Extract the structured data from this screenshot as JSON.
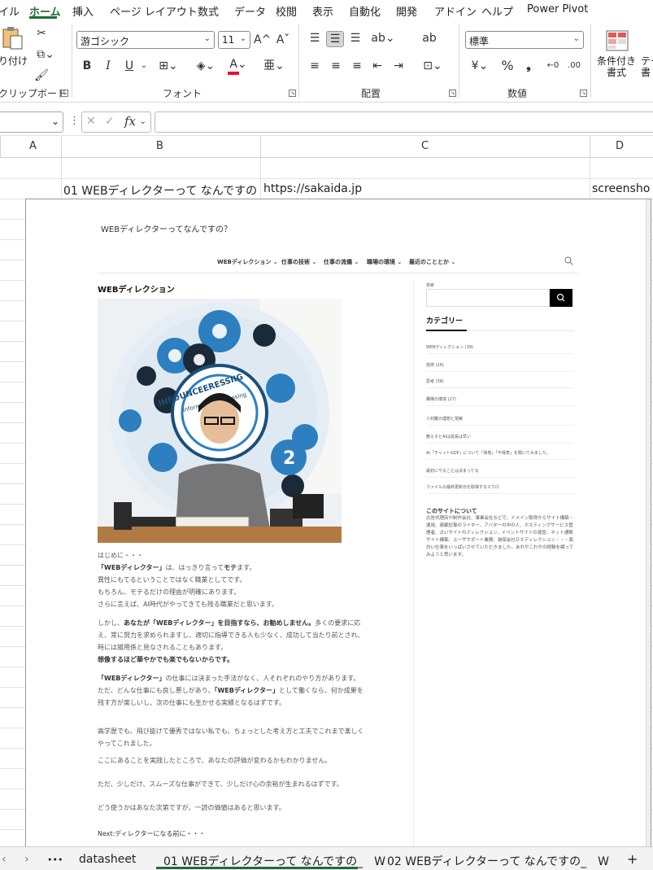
{
  "menu": {
    "items": [
      "イル",
      "ホーム",
      "挿入",
      "ページ レイアウト",
      "数式",
      "データ",
      "校閲",
      "表示",
      "自動化",
      "開発",
      "アドイン",
      "ヘルプ",
      "Power Pivot"
    ],
    "active": "ホーム"
  },
  "ribbon": {
    "paste_label": "り付け",
    "clipboard_label": "クリップボード",
    "font_name": "游ゴシック",
    "font_size": "11",
    "font_group_label": "フォント",
    "bold": "B",
    "italic": "I",
    "underline": "U",
    "align_group_label": "配置",
    "number_format": "標準",
    "number_group_label": "数値",
    "cond_format_label": "条件付き\n書式",
    "table_label": "テー\n書",
    "font_color": "#e81123",
    "accent": "#1e6b3a"
  },
  "formula_bar": {
    "fx": "fx",
    "value": ""
  },
  "columns": [
    "A",
    "B",
    "C",
    "D"
  ],
  "row2": {
    "b": "01 WEBディレクターって なんですの",
    "c": "https://sakaida.jp",
    "d": "screensho"
  },
  "screenshot": {
    "site_title": "WEBディレクターってなんですの？",
    "nav": [
      "WEBディレクション ⌄",
      "仕事の技術 ⌄",
      "仕事の流儀 ⌄",
      "職場の環境 ⌄",
      "最近のこととか ⌄"
    ],
    "post_title": "WEBディレクション",
    "hero_text": "INFOUNCEERESSIIG",
    "hero_subtext": "Information processing",
    "hero_badge": "2",
    "body": {
      "p1": [
        "はじめに・・・",
        "は、はっきり言って",
        "ます。",
        "異性にもてるということではなく職業としてです。",
        "もちろん、モテるだけの理由が明確にあります。",
        "さらに言えば、AI時代がやってきても残る職業だと思います。"
      ],
      "p1_bold": [
        "「WEBディレクター」",
        "モテ"
      ],
      "p2": [
        "しかし、",
        "多くの要求に応",
        "え、常に努力を求められますし、適切に指導できる人も少なく、成功して当たり前とされ、",
        "時には雑用係と見なされることもあります。"
      ],
      "p2_bold": [
        "あなたが「WEBディレクター」を目指すなら、お勧めしません。",
        "想像するほど華やかでも楽でもないからです。"
      ],
      "p3": [
        "の仕事には決まった手法がなく、人それぞれのやり方があります。",
        "ただ、どんな仕事にも良し悪しがあり、",
        "として働くなら、何か成果を",
        "残す方が楽しいし、次の仕事にも生かせる実績となるはずです。"
      ],
      "p3_bold": [
        "「WEBディレクター」",
        "「WEBディレクター」"
      ],
      "p4": [
        "高学歴でも、飛び抜けて優秀ではない私でも、ちょっとした考え方と工夫でこれまで楽しく",
        "やってこれました。"
      ],
      "p5": "ここにあることを実践したところで、あなたの評価が変わるかもわかりません。",
      "p6": "ただ、少しだけ、スムーズな仕事ができて、少しだけ心の余裕が生まれるはずです。",
      "p7": "どう使うかはあなた次第ですが、一読の価値はあると思います。"
    },
    "next_prefix": "Next:",
    "next_link": "ディレクターになる前に・・・",
    "sidebar": {
      "search_label": "検索",
      "categories_heading": "カテゴリー",
      "categories": [
        "WEBディレクション (39)",
        "技術 (26)",
        "思考 (38)",
        "職場の環境 (27)"
      ],
      "recent": [
        "人材難の理想と現実",
        "教え子とAIは成長は早い",
        "AI「チャットGDP」について「得意」「不得意」を聞いてみました。",
        "最初にやることは決まってる",
        "ファイルの最終更新日を取得するマクロ"
      ],
      "about_heading": "このサイトについて",
      "about_text": "広告代理店や制作会社、事業会社などで、ドメイン取得からサイト構築・運用、連載記事のライター、アバターの中の人、ホスティングサービス管理者、占いサイトのディレクション、イベントサイトの運営、ネット通販サイト構築、ユーザサポート業務、損保会社ＤＸディレクション・・・面白い仕事をいっぱいさせていただきました。あれやこれやの経験を綴ってみようと思います。"
    }
  },
  "tabs": {
    "nav_left": "‹",
    "nav_right": "›",
    "more": "•••",
    "items": [
      "datasheet",
      "01 WEBディレクターって なんですの_　W",
      "02 WEBディレクターって なんですの_　W"
    ],
    "add": "+"
  }
}
